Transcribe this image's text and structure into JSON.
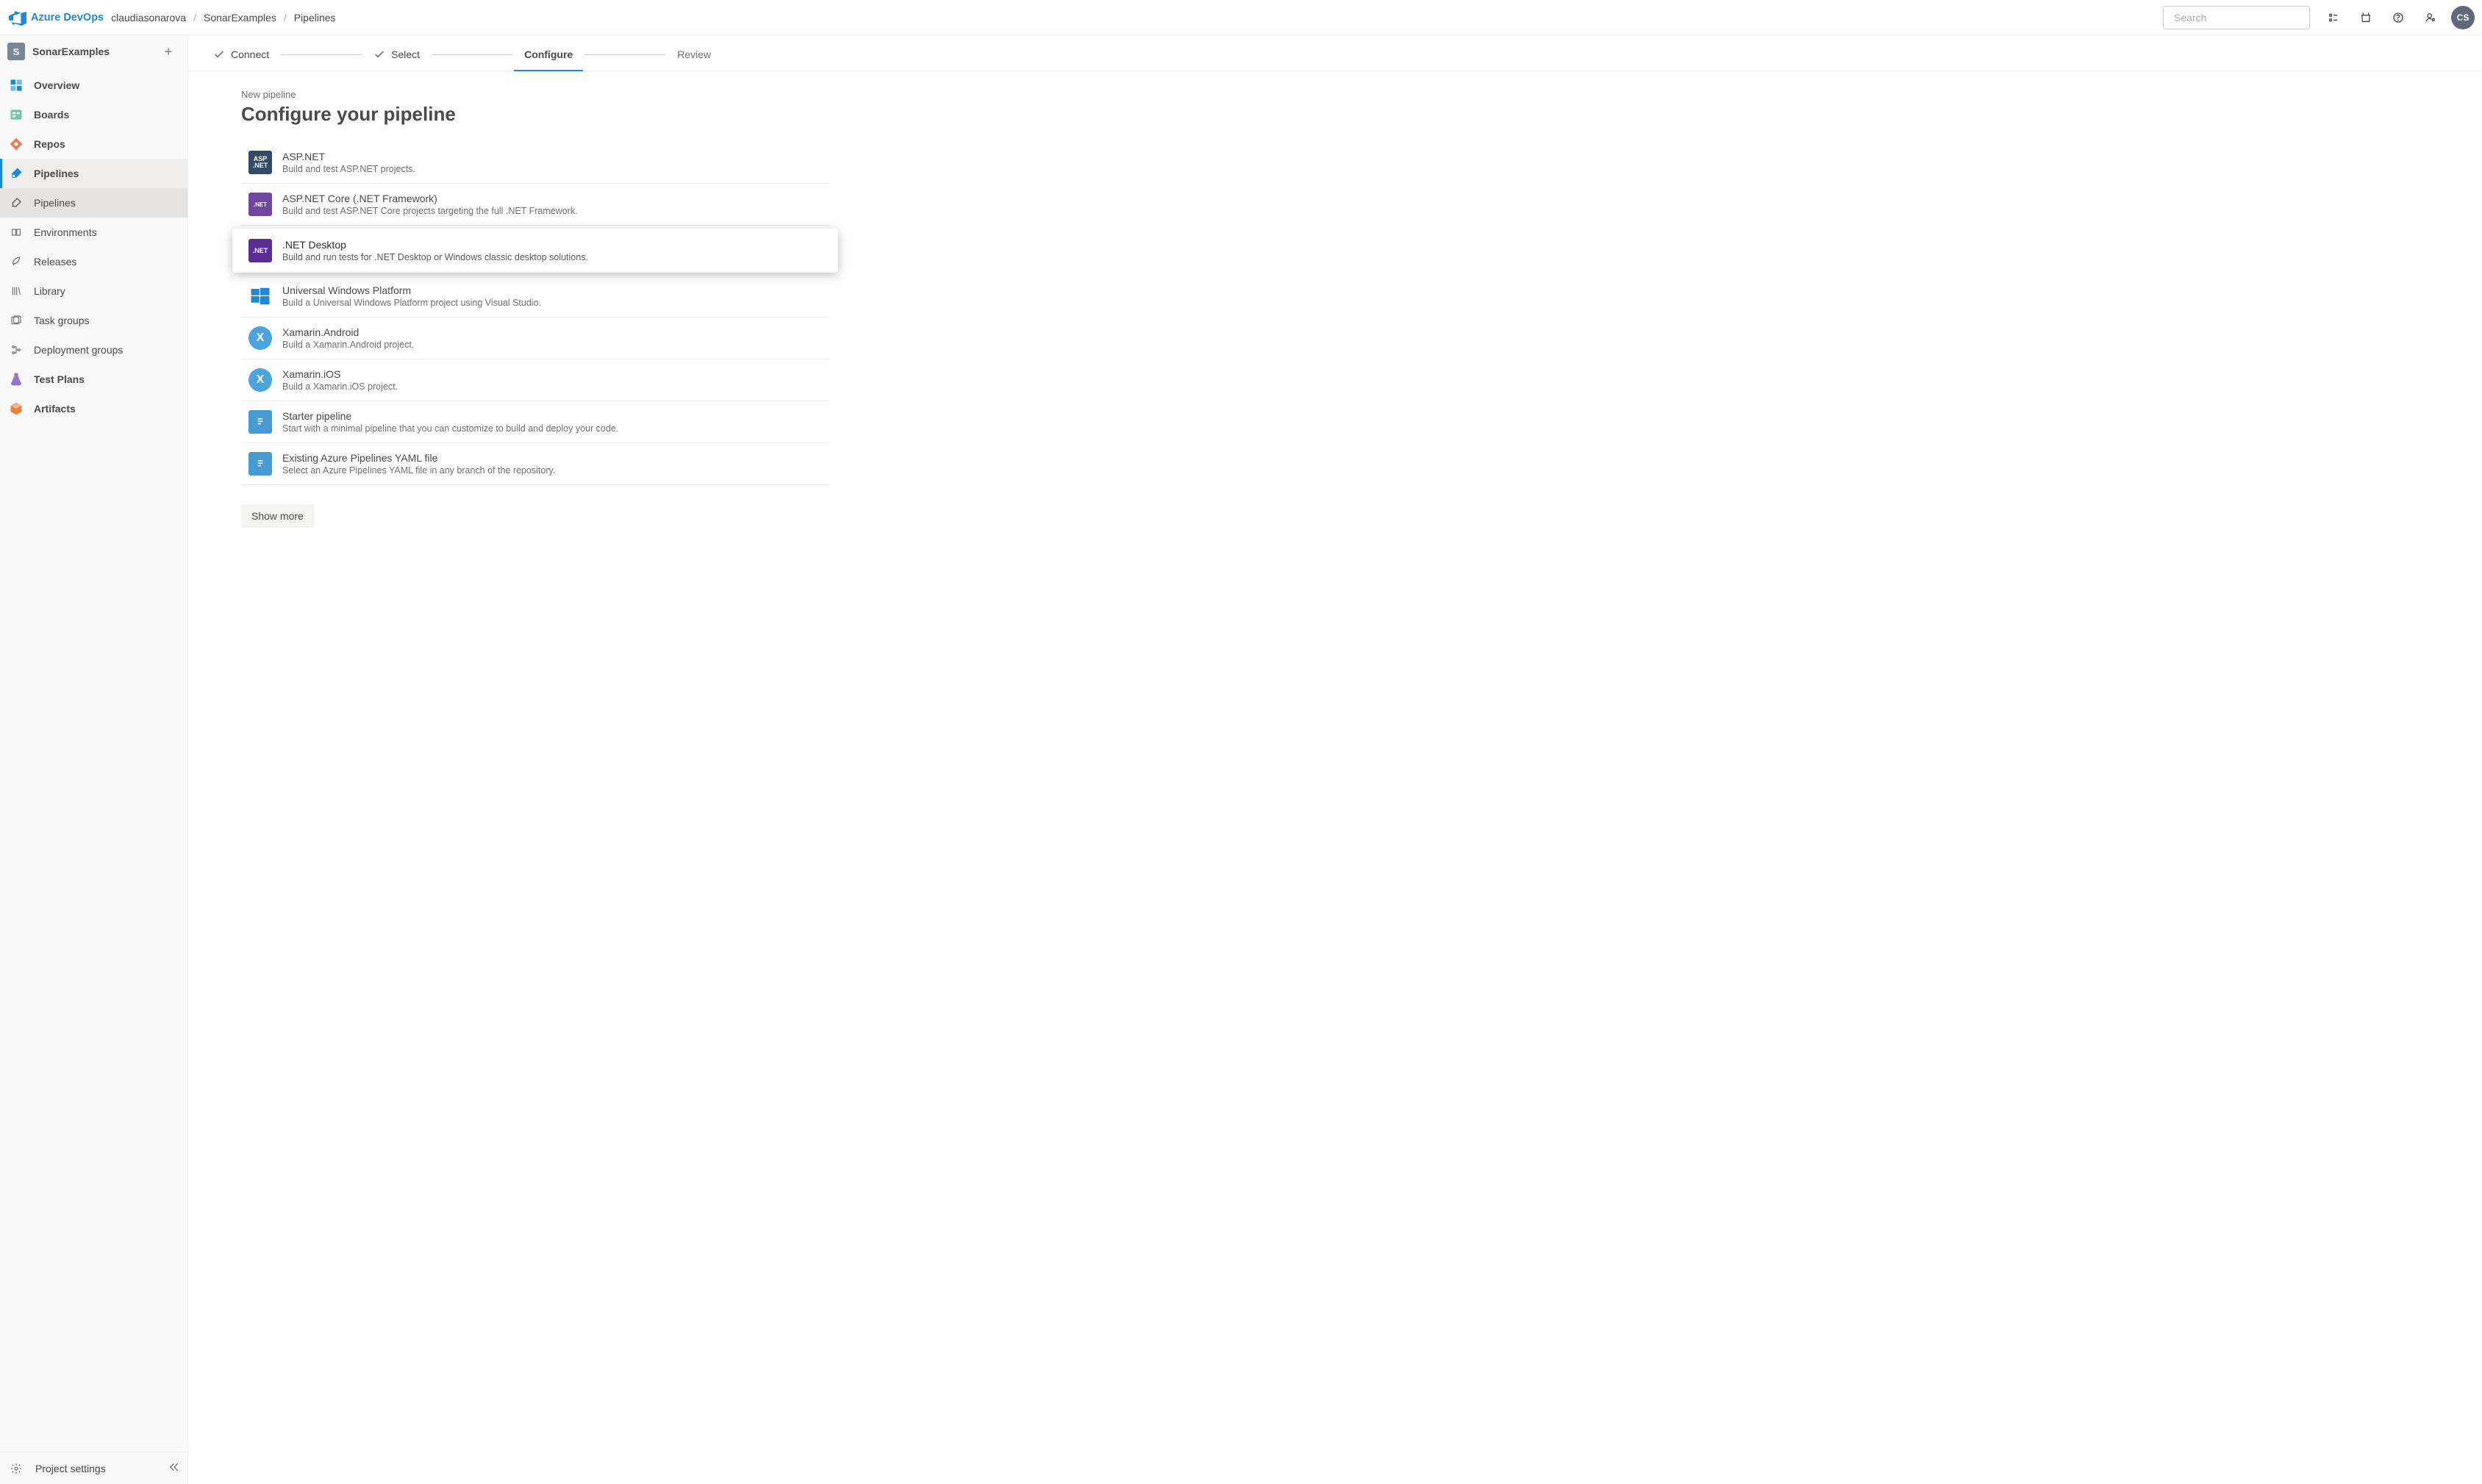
{
  "header": {
    "brand": "Azure DevOps",
    "breadcrumbs": [
      "claudiasonarova",
      "SonarExamples",
      "Pipelines"
    ],
    "search_placeholder": "Search",
    "avatar_initials": "CS"
  },
  "project": {
    "badge_letter": "S",
    "name": "SonarExamples"
  },
  "sidebar": {
    "items": [
      {
        "label": "Overview"
      },
      {
        "label": "Boards"
      },
      {
        "label": "Repos"
      },
      {
        "label": "Pipelines"
      },
      {
        "label": "Test Plans"
      },
      {
        "label": "Artifacts"
      }
    ],
    "pipelines_sub": [
      {
        "label": "Pipelines"
      },
      {
        "label": "Environments"
      },
      {
        "label": "Releases"
      },
      {
        "label": "Library"
      },
      {
        "label": "Task groups"
      },
      {
        "label": "Deployment groups"
      }
    ],
    "footer": "Project settings"
  },
  "wizard": {
    "steps": [
      {
        "label": "Connect",
        "done": true
      },
      {
        "label": "Select",
        "done": true
      },
      {
        "label": "Configure",
        "active": true
      },
      {
        "label": "Review"
      }
    ]
  },
  "page": {
    "overline": "New pipeline",
    "title": "Configure your pipeline",
    "show_more": "Show more"
  },
  "templates": [
    {
      "title": "ASP.NET",
      "desc": "Build and test ASP.NET projects.",
      "icon": "aspnet"
    },
    {
      "title": "ASP.NET Core (.NET Framework)",
      "desc": "Build and test ASP.NET Core projects targeting the full .NET Framework.",
      "icon": "netcore"
    },
    {
      "title": ".NET Desktop",
      "desc": "Build and run tests for .NET Desktop or Windows classic desktop solutions.",
      "icon": "netdesktop",
      "highlight": true
    },
    {
      "title": "Universal Windows Platform",
      "desc": "Build a Universal Windows Platform project using Visual Studio.",
      "icon": "uwp"
    },
    {
      "title": "Xamarin.Android",
      "desc": "Build a Xamarin.Android project.",
      "icon": "xam"
    },
    {
      "title": "Xamarin.iOS",
      "desc": "Build a Xamarin.iOS project.",
      "icon": "xam"
    },
    {
      "title": "Starter pipeline",
      "desc": "Start with a minimal pipeline that you can customize to build and deploy your code.",
      "icon": "yaml"
    },
    {
      "title": "Existing Azure Pipelines YAML file",
      "desc": "Select an Azure Pipelines YAML file in any branch of the repository.",
      "icon": "yaml"
    }
  ]
}
